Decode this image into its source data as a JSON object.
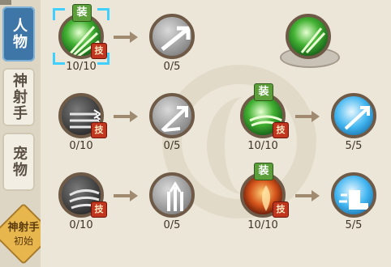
{
  "sidebar": {
    "tabs": [
      {
        "label": "人物",
        "active": true
      },
      {
        "label": "神射手",
        "active": false
      },
      {
        "label": "宠物",
        "active": false
      }
    ],
    "class_badge": {
      "title": "神射手",
      "subtitle": "初始"
    }
  },
  "badges": {
    "equip": "装",
    "tech": "技"
  },
  "skills": {
    "row1": [
      {
        "count": "10/10",
        "style": "green",
        "equipped": true,
        "technique": true,
        "selected": true
      },
      {
        "count": "0/5",
        "style": "gray"
      },
      {
        "count": "",
        "style": "green"
      }
    ],
    "row2": [
      {
        "count": "0/10",
        "style": "dark",
        "technique": true
      },
      {
        "count": "0/5",
        "style": "gray"
      },
      {
        "count": "10/10",
        "style": "green",
        "equipped": true,
        "technique": true
      },
      {
        "count": "5/5",
        "style": "blue"
      }
    ],
    "row3": [
      {
        "count": "0/10",
        "style": "dark",
        "technique": true
      },
      {
        "count": "0/5",
        "style": "gray"
      },
      {
        "count": "10/10",
        "style": "fire",
        "equipped": true,
        "technique": true
      },
      {
        "count": "5/5",
        "style": "blue"
      }
    ]
  },
  "colors": {
    "accent": "#3e76a8",
    "select": "#3fd0ff",
    "arrow": "#a08a70"
  }
}
